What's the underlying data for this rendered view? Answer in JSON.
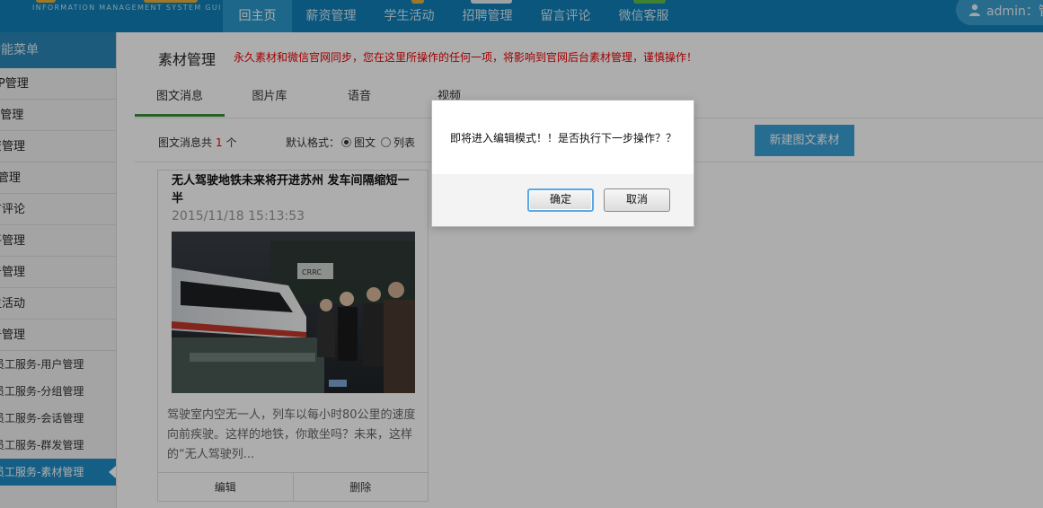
{
  "header": {
    "logo_subtitle": "INFORMATION MANAGEMENT SYSTEM GUI",
    "nav": [
      {
        "label": "回主页",
        "active": true
      },
      {
        "label": "薪资管理",
        "active": false
      },
      {
        "label": "学生活动",
        "active": false
      },
      {
        "label": "招聘管理",
        "active": false
      },
      {
        "label": "留言评论",
        "active": false
      },
      {
        "label": "微信客服",
        "active": false
      }
    ],
    "user_text": "admin：管"
  },
  "sidebar": {
    "title": "功能菜单",
    "items": [
      "AP管理",
      "M管理",
      "资管理",
      "P管理",
      "言评论",
      "平管理",
      "告管理",
      "生活动",
      "告管理"
    ],
    "subitems": [
      "员工服务-用户管理",
      "员工服务-分组管理",
      "员工服务-会话管理",
      "员工服务-群发管理",
      "员工服务-素材管理"
    ]
  },
  "main": {
    "title": "素材管理",
    "warning": "永久素材和微信官网同步，您在这里所操作的任何一项，将影响到官网后台素材管理，谨慎操作！",
    "tabs": [
      "图文消息",
      "图片库",
      "语音",
      "视频"
    ],
    "count_prefix": "图文消息共",
    "count_value": "1",
    "count_suffix": "个",
    "format_label": "默认格式：",
    "format_options": [
      "图文",
      "列表"
    ],
    "new_button": "新建图文素材"
  },
  "card": {
    "title": "无人驾驶地铁未来将开进苏州 发车间隔缩短一半",
    "date": "2015/11/18 15:13:53",
    "description": "驾驶室内空无一人，列车以每小时80公里的速度向前疾驶。这样的地铁，你敢坐吗？未来，这样的“无人驾驶列...",
    "edit": "编辑",
    "delete": "删除",
    "image_sign": "CRRC"
  },
  "dialog": {
    "message": "即将进入编辑模式！！是否执行下一步操作？？",
    "confirm": "确定",
    "cancel": "取消"
  },
  "colors": {
    "header_bg": "#0f7fb8",
    "accent": "#1f8dc6",
    "warning": "#e00000",
    "tab_active": "#3a8f3a",
    "button": "#3aa0d6"
  }
}
